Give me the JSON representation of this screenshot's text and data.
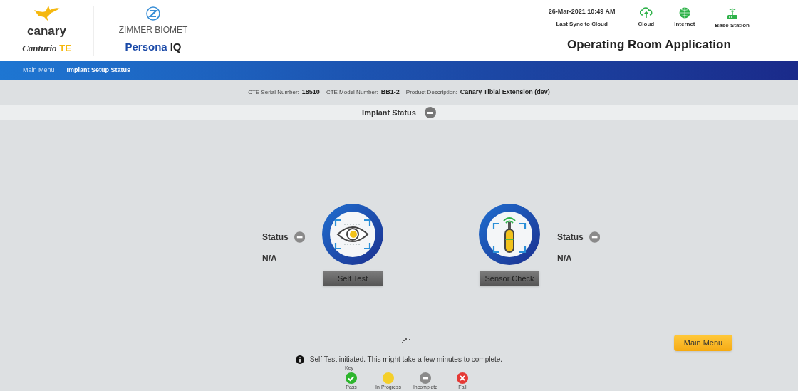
{
  "header": {
    "canary_logo": {
      "brand": "canary",
      "product_name": "Canturio",
      "product_suffix": "TE"
    },
    "partner_logo": {
      "brand": "ZIMMER BIOMET",
      "product_name": "Persona",
      "product_suffix": "IQ"
    },
    "sync": {
      "timestamp": "26-Mar-2021 10:49 AM",
      "label": "Last Sync to Cloud"
    },
    "connections": [
      {
        "kind": "cloud",
        "label": "Cloud"
      },
      {
        "kind": "internet",
        "label": "Internet"
      },
      {
        "kind": "base",
        "label": "Base Station"
      }
    ],
    "app_title": "Operating Room Application"
  },
  "breadcrumb": [
    {
      "label": "Main Menu",
      "selected": false
    },
    {
      "label": "Implant Setup Status",
      "selected": true
    }
  ],
  "device_info": [
    {
      "label": "CTE Serial Number:",
      "value": "18510"
    },
    {
      "label": "CTE Model Number:",
      "value": "BB1-2"
    },
    {
      "label": "Product Description:",
      "value": "Canary Tibial Extension (dev)"
    }
  ],
  "section": {
    "title": "Implant Status",
    "expanded": true
  },
  "tests": [
    {
      "kind": "self_test",
      "button": "Self Test",
      "status_label": "Status",
      "status_icon": {
        "kind": "incomplete"
      },
      "result": "N/A"
    },
    {
      "kind": "sensor_check",
      "button": "Sensor Check",
      "status_label": "Status",
      "status_icon": {
        "kind": "incomplete"
      },
      "result": "N/A"
    }
  ],
  "message": "Self Test initiated. This might take a few minutes to complete.",
  "main_menu_button": "Main Menu",
  "key": {
    "title": "Key",
    "items": [
      {
        "kind": "pass",
        "label": "Pass",
        "color": "#2db52d"
      },
      {
        "kind": "in_progress",
        "label": "In Progress",
        "color": "#f4cf2a"
      },
      {
        "kind": "incomplete",
        "label": "Incomplete",
        "color": "#8a8a8a"
      },
      {
        "kind": "fail",
        "label": "Fail",
        "color": "#e53935"
      }
    ]
  }
}
